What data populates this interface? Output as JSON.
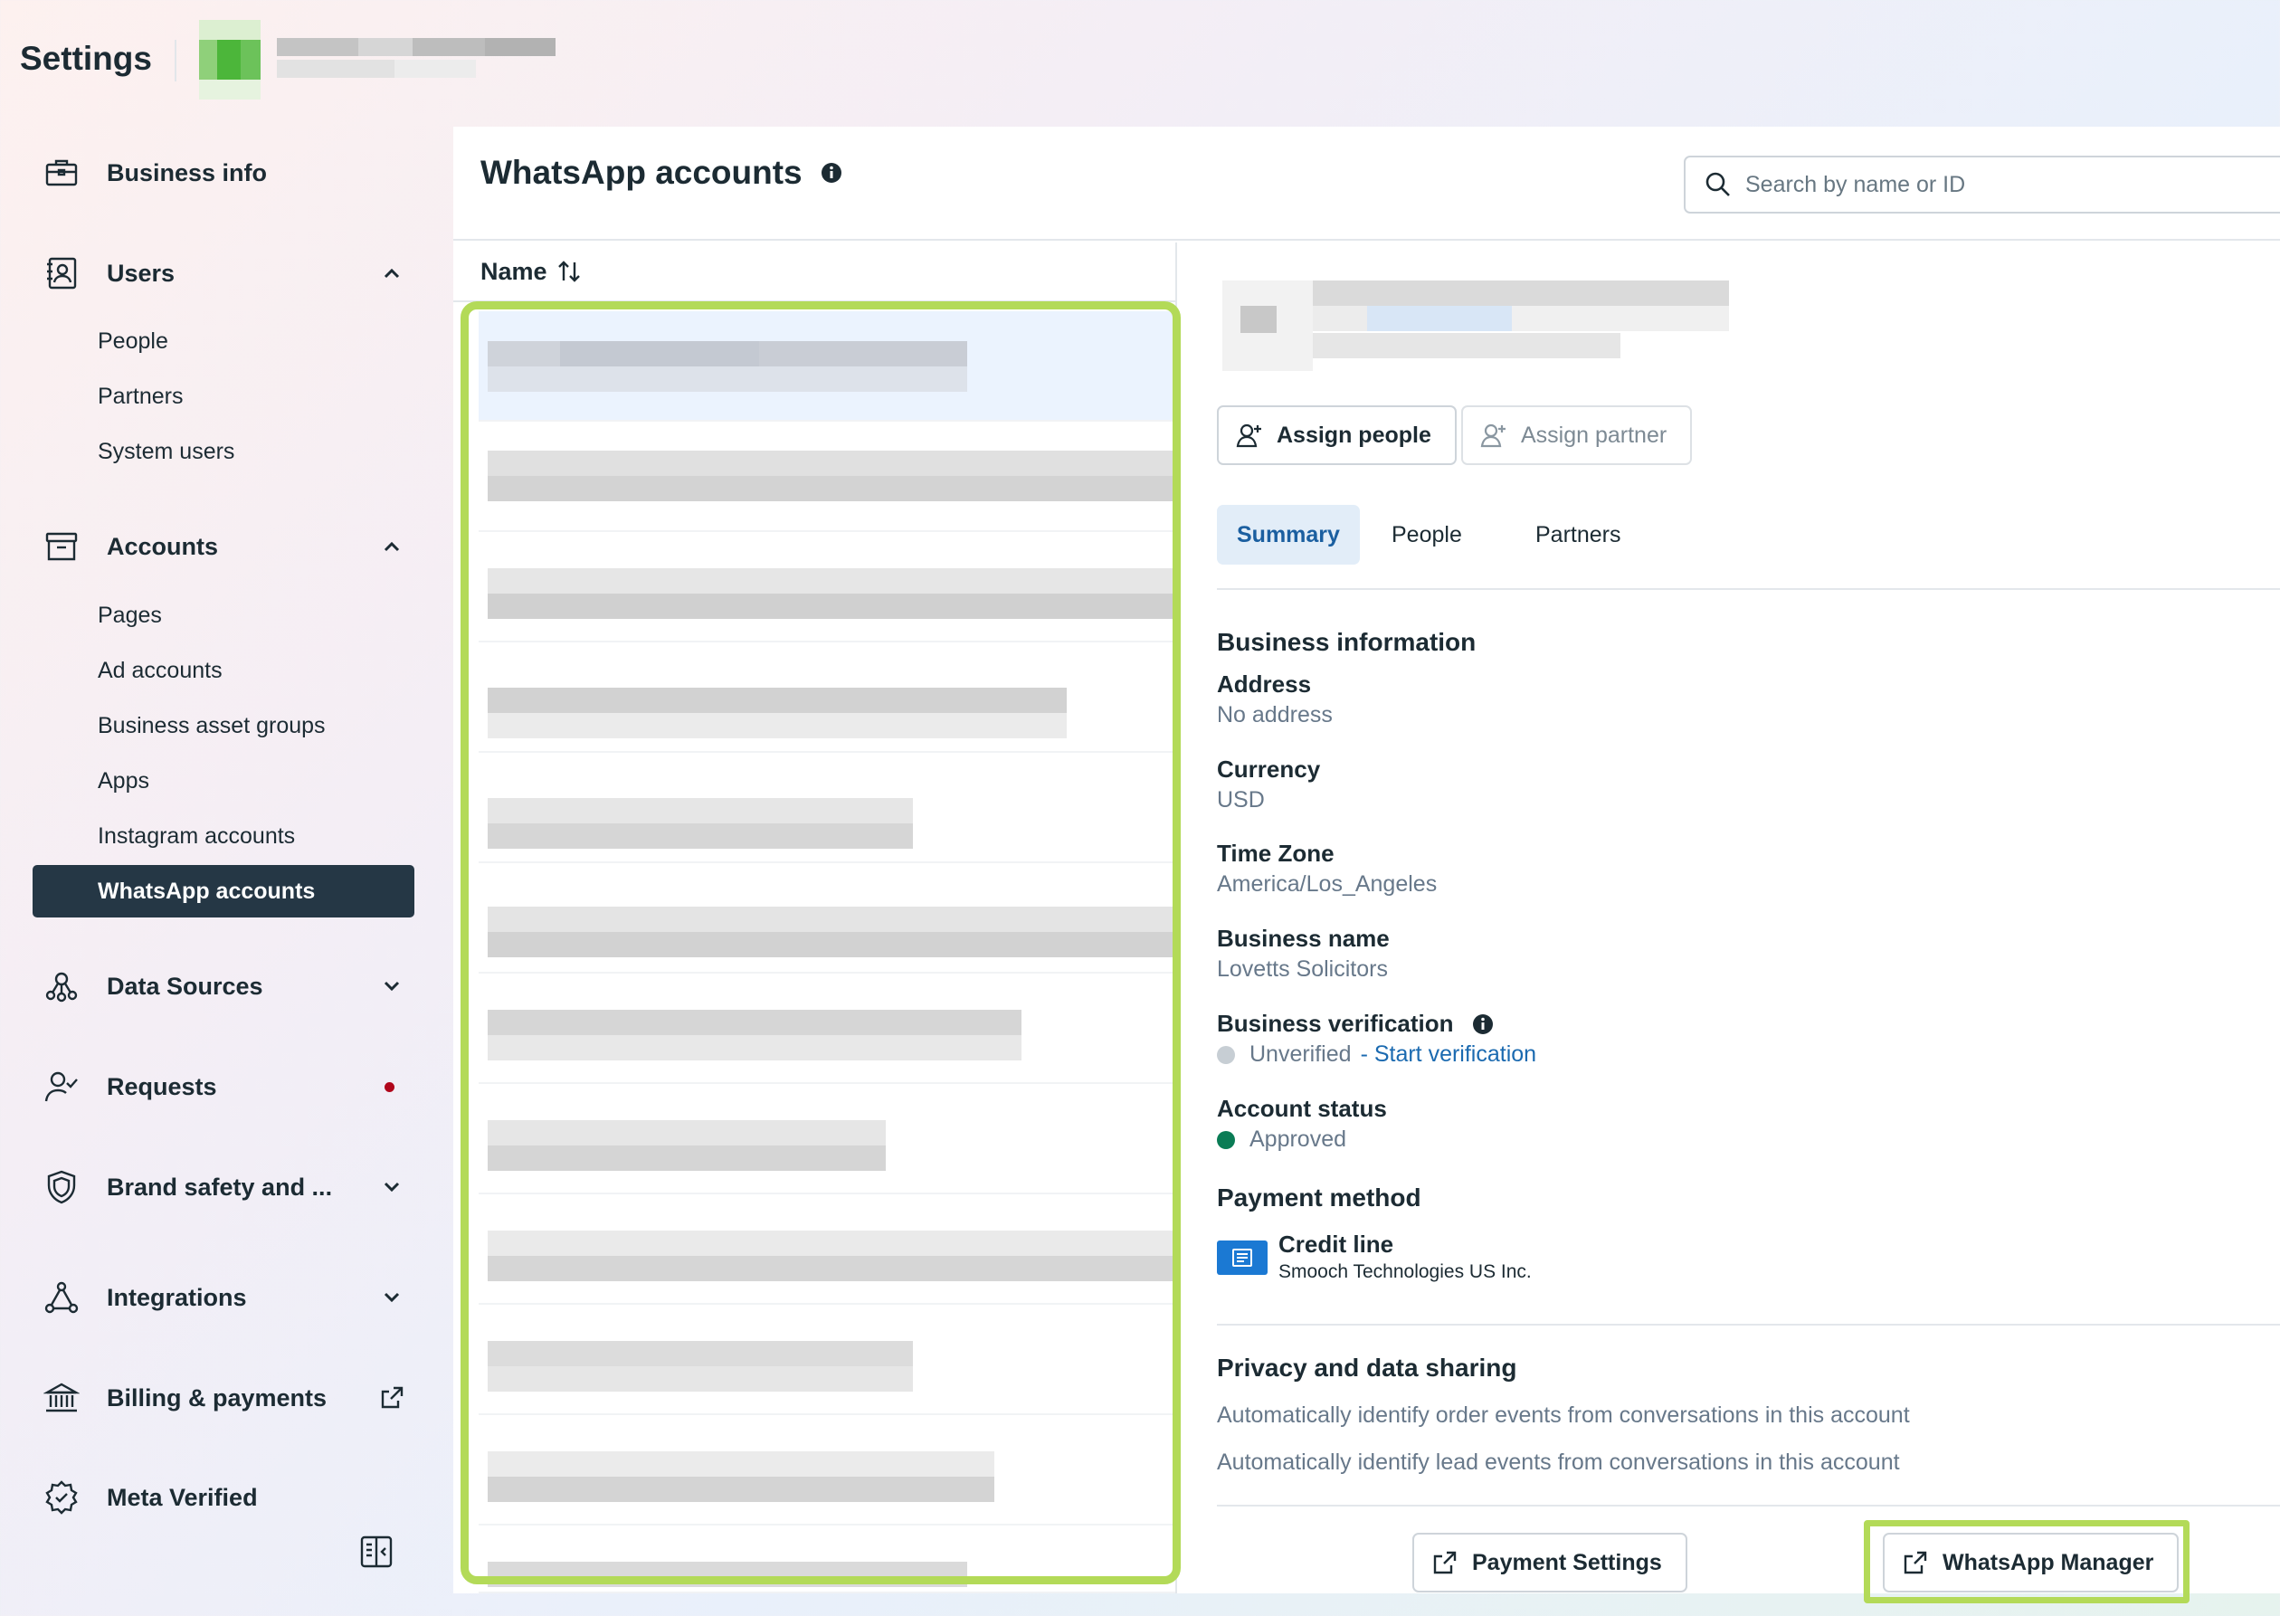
{
  "header": {
    "title": "Settings"
  },
  "sidebar": {
    "business_info": "Business info",
    "users": {
      "label": "Users",
      "items": [
        "People",
        "Partners",
        "System users"
      ]
    },
    "accounts": {
      "label": "Accounts",
      "items": [
        "Pages",
        "Ad accounts",
        "Business asset groups",
        "Apps",
        "Instagram accounts",
        "WhatsApp accounts"
      ],
      "active_item": "WhatsApp accounts"
    },
    "data_sources": "Data Sources",
    "requests": "Requests",
    "brand_safety": "Brand safety and ...",
    "integrations": "Integrations",
    "billing": "Billing & payments",
    "meta_verified": "Meta Verified"
  },
  "main": {
    "title": "WhatsApp accounts",
    "search_placeholder": "Search by name or ID",
    "list": {
      "column_header": "Name"
    }
  },
  "detail": {
    "assign_people": "Assign people",
    "assign_partner": "Assign partner",
    "tabs": [
      "Summary",
      "People",
      "Partners"
    ],
    "active_tab": "Summary",
    "business_information": {
      "title": "Business information",
      "address_label": "Address",
      "address_value": "No address",
      "currency_label": "Currency",
      "currency_value": "USD",
      "timezone_label": "Time Zone",
      "timezone_value": "America/Los_Angeles",
      "business_name_label": "Business name",
      "business_name_value": "Lovetts Solicitors",
      "verification_label": "Business verification",
      "verification_value": "Unverified",
      "verification_link": "- Start verification",
      "account_status_label": "Account status",
      "account_status_value": "Approved"
    },
    "payment": {
      "title": "Payment method",
      "method_name": "Credit line",
      "provider": "Smooch Technologies US Inc."
    },
    "privacy": {
      "title": "Privacy and data sharing",
      "order_events": "Automatically identify order events from conversations in this account",
      "lead_events": "Automatically identify lead events from conversations in this account"
    },
    "footer": {
      "payment_settings": "Payment Settings",
      "whatsapp_manager": "WhatsApp Manager"
    }
  },
  "colors": {
    "active_nav_bg": "#253745",
    "highlight": "#b3da58",
    "link": "#1b6ab0",
    "approved": "#0a7c55",
    "unverified": "#c7ced4",
    "card_blue": "#1b79d3"
  },
  "icons": {
    "business_info": "briefcase-icon",
    "users": "id-badge-icon",
    "accounts": "archive-box-icon",
    "data_sources": "nodes-icon",
    "requests": "person-check-icon",
    "brand_safety": "shield-icon",
    "integrations": "triangle-nodes-icon",
    "billing": "bank-icon",
    "meta_verified": "verified-badge-icon"
  }
}
